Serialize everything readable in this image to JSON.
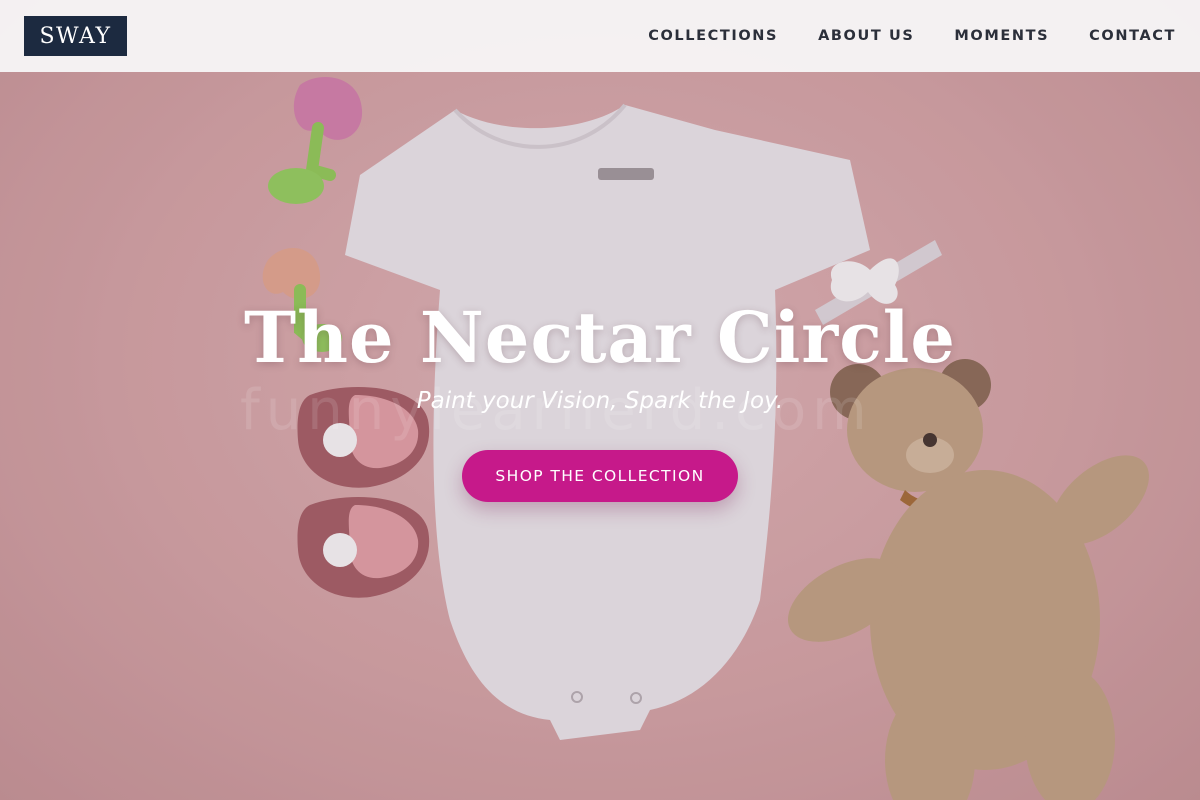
{
  "brand": {
    "logo_text": "SWAY",
    "logo_bg": "#1c2a40"
  },
  "nav": {
    "items": [
      {
        "label": "COLLECTIONS"
      },
      {
        "label": "ABOUT US"
      },
      {
        "label": "MOMENTS"
      },
      {
        "label": "CONTACT"
      }
    ]
  },
  "hero": {
    "title": "The Nectar Circle",
    "subtitle": "Paint your Vision, Spark the Joy.",
    "cta_label": "SHOP THE COLLECTION",
    "cta_color": "#c6198a",
    "background_color": "#d9a9aa",
    "watermark": "funnylearnerd.com"
  },
  "icons": {
    "scene": [
      "teether-toy-icon",
      "onesie-icon",
      "hair-bow-icon",
      "baby-booties-icon",
      "teddy-bear-icon"
    ]
  }
}
